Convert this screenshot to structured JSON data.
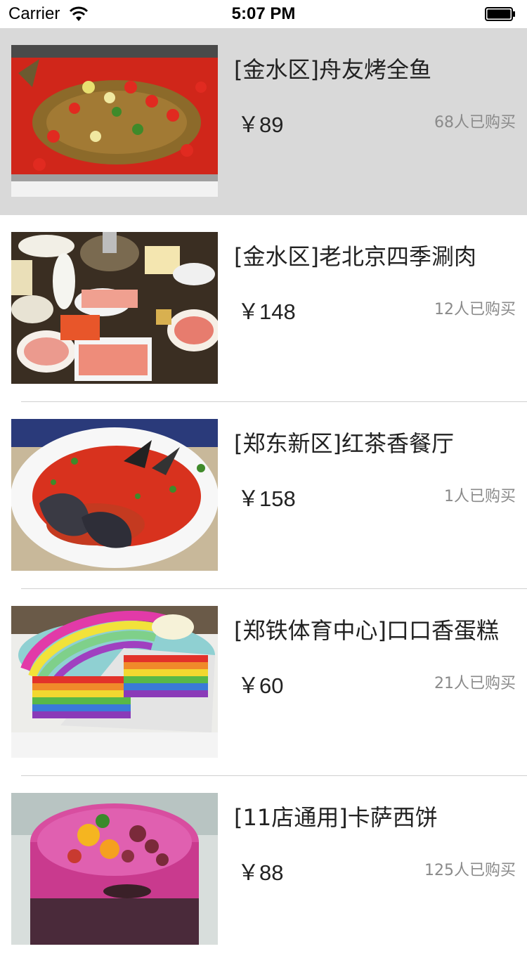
{
  "status_bar": {
    "carrier": "Carrier",
    "time": "5:07 PM",
    "icons": [
      "wifi-icon",
      "battery-icon"
    ]
  },
  "deals": [
    {
      "title": "[金水区]舟友烤全鱼",
      "price": "￥89",
      "sold": "68人已购买",
      "selected": true,
      "image": "grilled-fish-photo"
    },
    {
      "title": "[金水区]老北京四季涮肉",
      "price": "￥148",
      "sold": "12人已购买",
      "selected": false,
      "image": "hotpot-spread-photo"
    },
    {
      "title": "[郑东新区]红茶香餐厅",
      "price": "￥158",
      "sold": "1人已购买",
      "selected": false,
      "image": "chili-fish-head-photo"
    },
    {
      "title": "[郑铁体育中心]口口香蛋糕",
      "price": "￥60",
      "sold": "21人已购买",
      "selected": false,
      "image": "rainbow-cake-photo"
    },
    {
      "title": "[11店通用]卡萨西饼",
      "price": "￥88",
      "sold": "125人已购买",
      "selected": false,
      "image": "fruit-birthday-cake-photo"
    }
  ],
  "colors": {
    "selected_row": "#d9d9d9",
    "separator": "#d0d0d0",
    "sold_text": "#8a8a8a"
  }
}
